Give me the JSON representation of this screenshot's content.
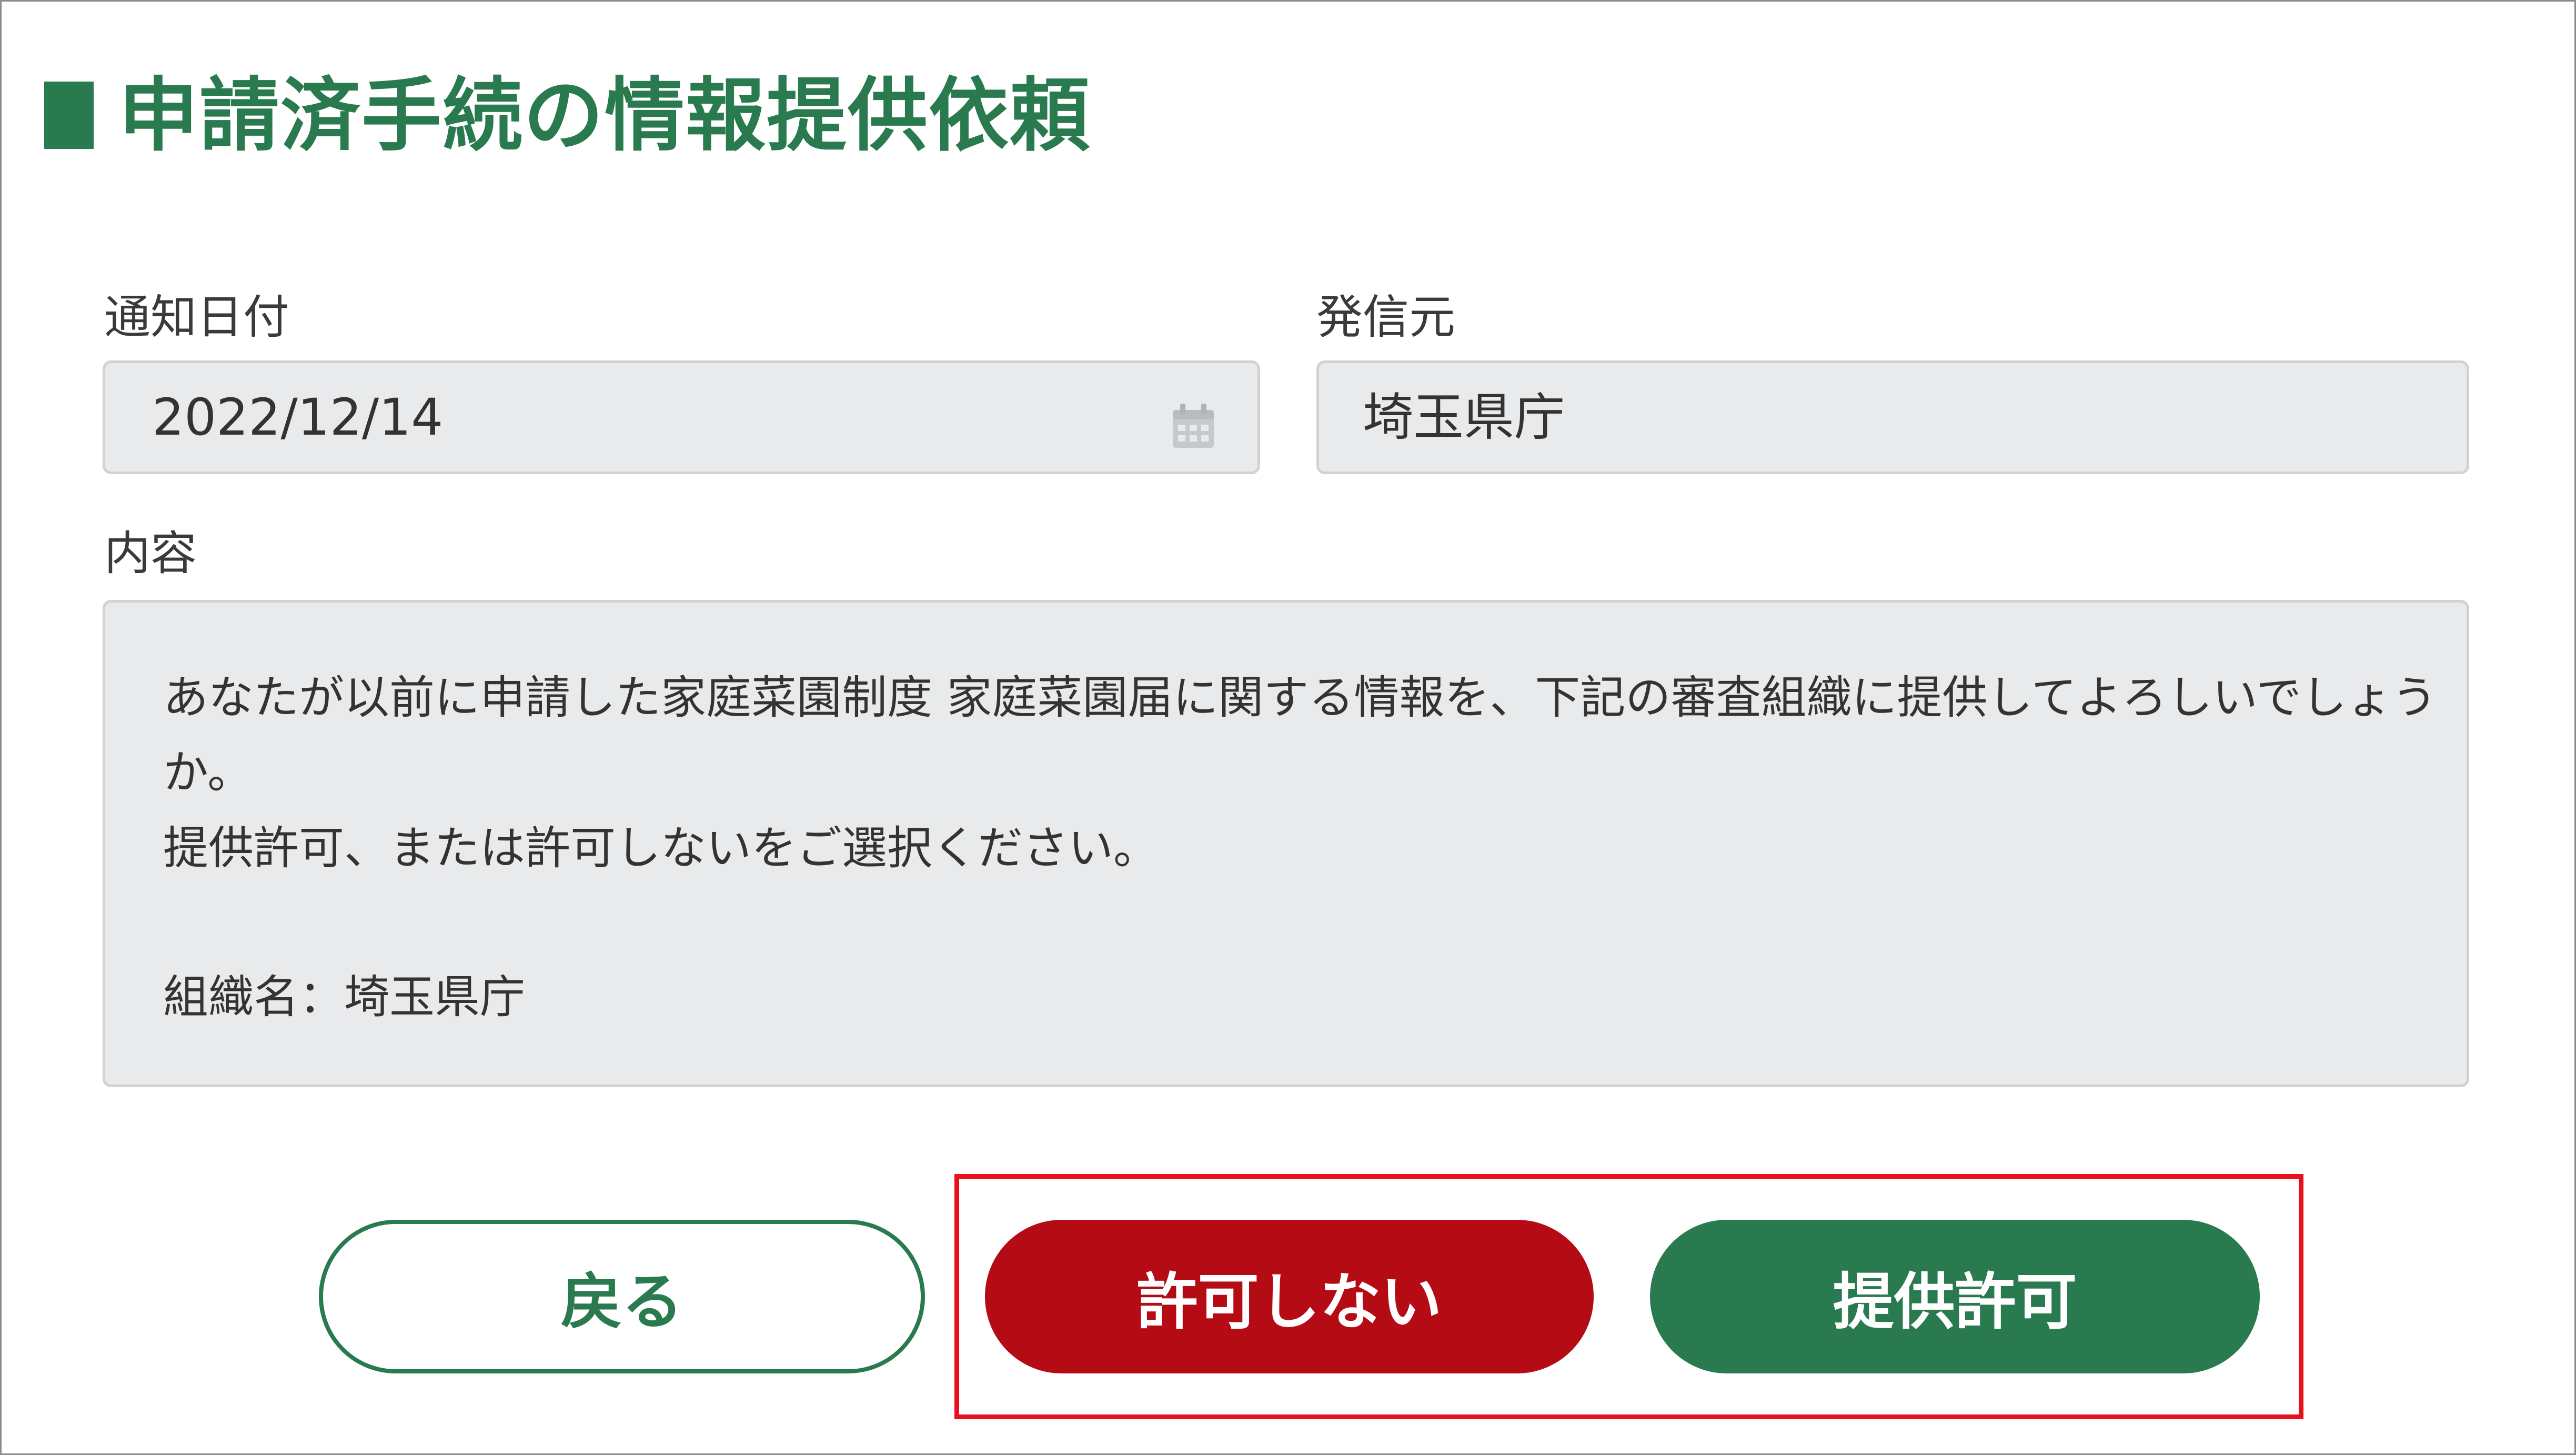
{
  "page": {
    "title": "申請済手続の情報提供依頼"
  },
  "form": {
    "notification_date_label": "通知日付",
    "notification_date_value": "2022/12/14",
    "sender_label": "発信元",
    "sender_value": "埼玉県庁",
    "content_label": "内容",
    "content_lines": [
      "あなたが以前に申請した家庭菜園制度 家庭菜園届に関する情報を、下記の審査組織に提供してよろしいでしょう",
      "か。",
      "提供許可、または許可しないをご選択ください。",
      "",
      "組織名：埼玉県庁"
    ]
  },
  "buttons": {
    "back_label": "戻る",
    "deny_label": "許可しない",
    "allow_label": "提供許可"
  },
  "icons": {
    "date_field_icon": "calendar-icon"
  },
  "colors": {
    "brand_green": "#2a7a4f",
    "deny_red": "#b50b15",
    "highlight_red": "#e8101a",
    "field_bg": "#e9eaeb"
  }
}
